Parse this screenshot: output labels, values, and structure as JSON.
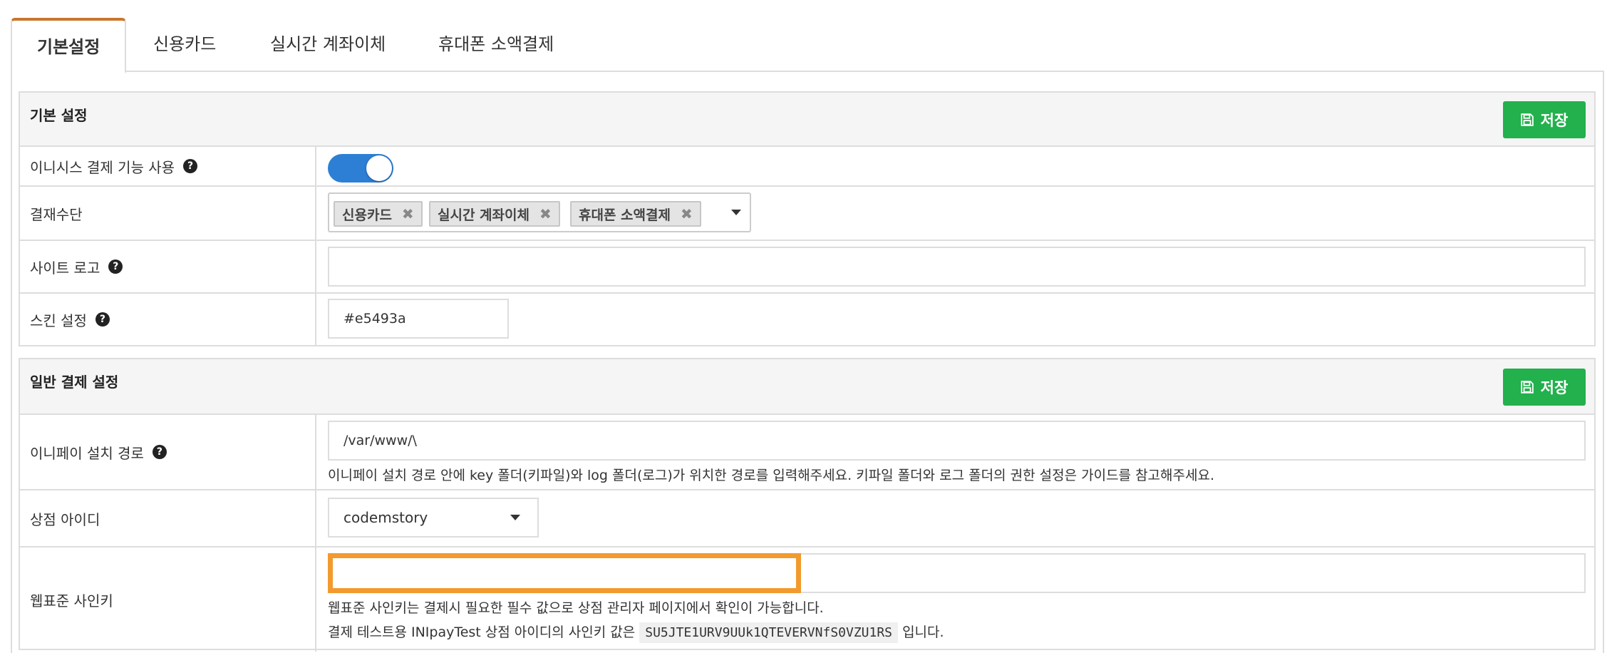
{
  "tabs": [
    {
      "label": "기본설정"
    },
    {
      "label": "신용카드"
    },
    {
      "label": "실시간 계좌이체"
    },
    {
      "label": "휴대폰 소액결제"
    }
  ],
  "basic_panel": {
    "title": "기본 설정",
    "save_label": "저장",
    "rows": {
      "enable": {
        "label": "이니시스 결제 기능 사용",
        "toggle_on": true
      },
      "methods": {
        "label": "결재수단",
        "tags": [
          "신용카드",
          "실시간 계좌이체",
          "휴대폰 소액결제"
        ]
      },
      "logo": {
        "label": "사이트 로고",
        "value": ""
      },
      "skin": {
        "label": "스킨 설정",
        "value": "#e5493a"
      }
    }
  },
  "general_panel": {
    "title": "일반 결제 설정",
    "save_label": "저장",
    "rows": {
      "path": {
        "label": "이니페이 설치 경로",
        "value": "/var/www/\\",
        "help": "이니페이 설치 경로 안에 key 폴더(키파일)와 log 폴더(로그)가 위치한 경로를 입력해주세요. 키파일 폴더와 로그 폴더의 권한 설정은 가이드를 참고해주세요."
      },
      "merchant": {
        "label": "상점 아이디",
        "value": "codemstory"
      },
      "signkey": {
        "label": "웹표준 사인키",
        "value": "",
        "help1": "웹표준 사인키는 결제시 필요한 필수 값으로 상점 관리자 페이지에서 확인이 가능합니다.",
        "help2_prefix": "결제 테스트용 INIpayTest 상점 아이디의 사인키 값은",
        "help2_code": "SU5JTE1URV9UUk1QTEVERVNfS0VZU1RS",
        "help2_suffix": "입니다."
      }
    }
  },
  "colors": {
    "save_button": "#22b14c",
    "toggle": "#2d7fd6",
    "active_tab_border": "#c9762d",
    "highlight": "#f29a2e"
  }
}
